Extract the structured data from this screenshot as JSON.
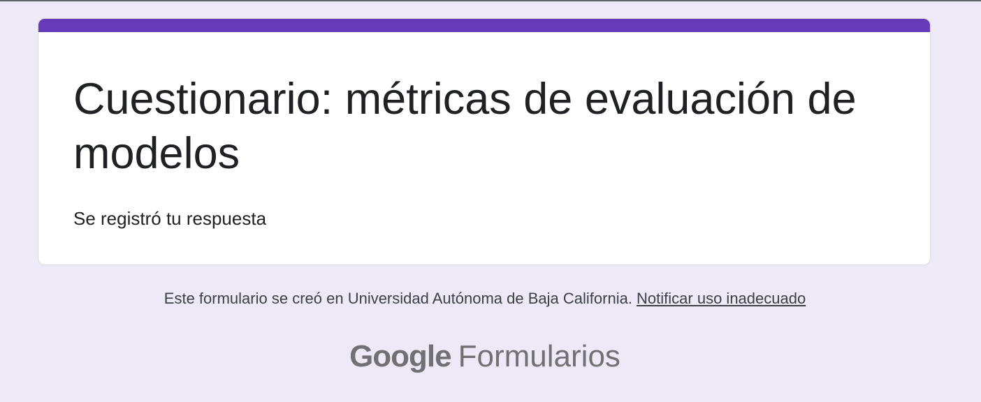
{
  "form": {
    "title": "Cuestionario: métricas de evaluación de modelos",
    "confirmation_message": "Se registró tu respuesta",
    "accent_color": "#673ab7"
  },
  "footer": {
    "created_in_text": "Este formulario se creó en Universidad Autónoma de Baja California.",
    "report_link_label": "Notificar uso inadecuado"
  },
  "branding": {
    "google_word": "Google",
    "product_word": "Formularios"
  },
  "colors": {
    "page_background": "#ede9f6",
    "card_background": "#ffffff",
    "text_primary": "#202124",
    "text_secondary": "#3c4043",
    "brand_gray": "#707075"
  }
}
